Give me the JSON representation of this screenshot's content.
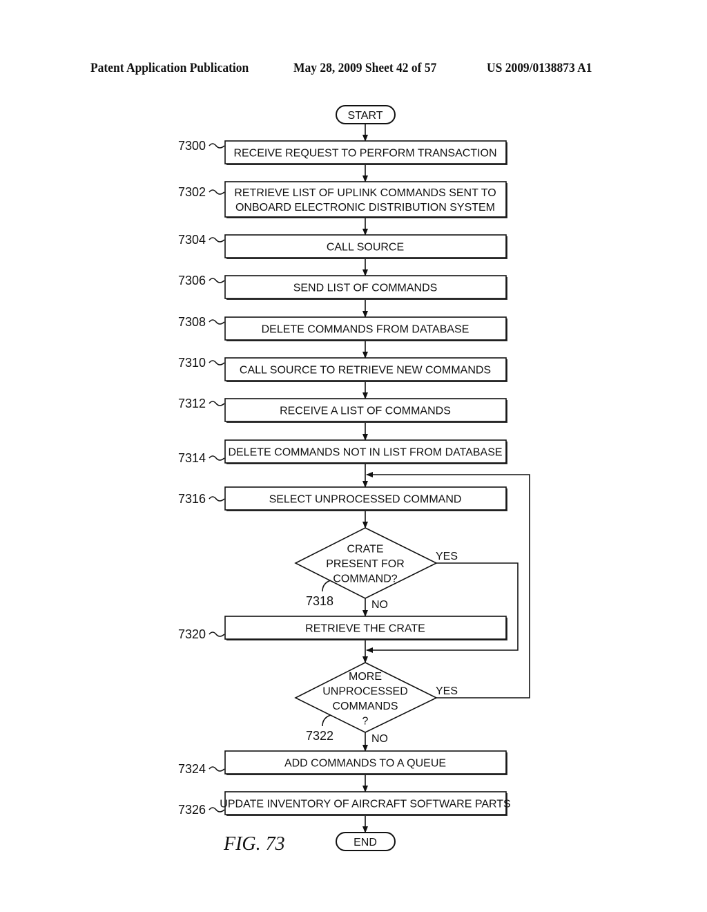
{
  "header": {
    "left": "Patent Application Publication",
    "date_sheet": "May 28, 2009  Sheet 42 of 57",
    "pub_number": "US 2009/0138873 A1"
  },
  "figure_label": "FIG. 73",
  "terminals": {
    "start": "START",
    "end": "END"
  },
  "steps": [
    {
      "ref": "7300",
      "lines": [
        "RECEIVE REQUEST TO PERFORM TRANSACTION"
      ]
    },
    {
      "ref": "7302",
      "lines": [
        "RETRIEVE LIST OF UPLINK COMMANDS SENT TO",
        "ONBOARD ELECTRONIC DISTRIBUTION SYSTEM"
      ]
    },
    {
      "ref": "7304",
      "lines": [
        "CALL SOURCE"
      ]
    },
    {
      "ref": "7306",
      "lines": [
        "SEND LIST OF COMMANDS"
      ]
    },
    {
      "ref": "7308",
      "lines": [
        "DELETE COMMANDS FROM DATABASE"
      ]
    },
    {
      "ref": "7310",
      "lines": [
        "CALL SOURCE TO RETRIEVE NEW COMMANDS"
      ]
    },
    {
      "ref": "7312",
      "lines": [
        "RECEIVE A LIST OF COMMANDS"
      ]
    },
    {
      "ref": "7314",
      "lines": [
        "DELETE COMMANDS NOT IN LIST FROM DATABASE"
      ]
    },
    {
      "ref": "7316",
      "lines": [
        "SELECT UNPROCESSED COMMAND"
      ]
    },
    {
      "ref": "7320",
      "lines": [
        "RETRIEVE THE CRATE"
      ]
    },
    {
      "ref": "7324",
      "lines": [
        "ADD COMMANDS TO A QUEUE"
      ]
    },
    {
      "ref": "7326",
      "lines": [
        "UPDATE INVENTORY OF AIRCRAFT SOFTWARE PARTS"
      ]
    }
  ],
  "decisions": [
    {
      "ref": "7318",
      "lines": [
        "CRATE",
        "PRESENT FOR",
        "COMMAND?"
      ],
      "yes": "YES",
      "no": "NO"
    },
    {
      "ref": "7322",
      "lines": [
        "MORE",
        "UNPROCESSED",
        "COMMANDS",
        "?"
      ],
      "yes": "YES",
      "no": "NO"
    }
  ]
}
